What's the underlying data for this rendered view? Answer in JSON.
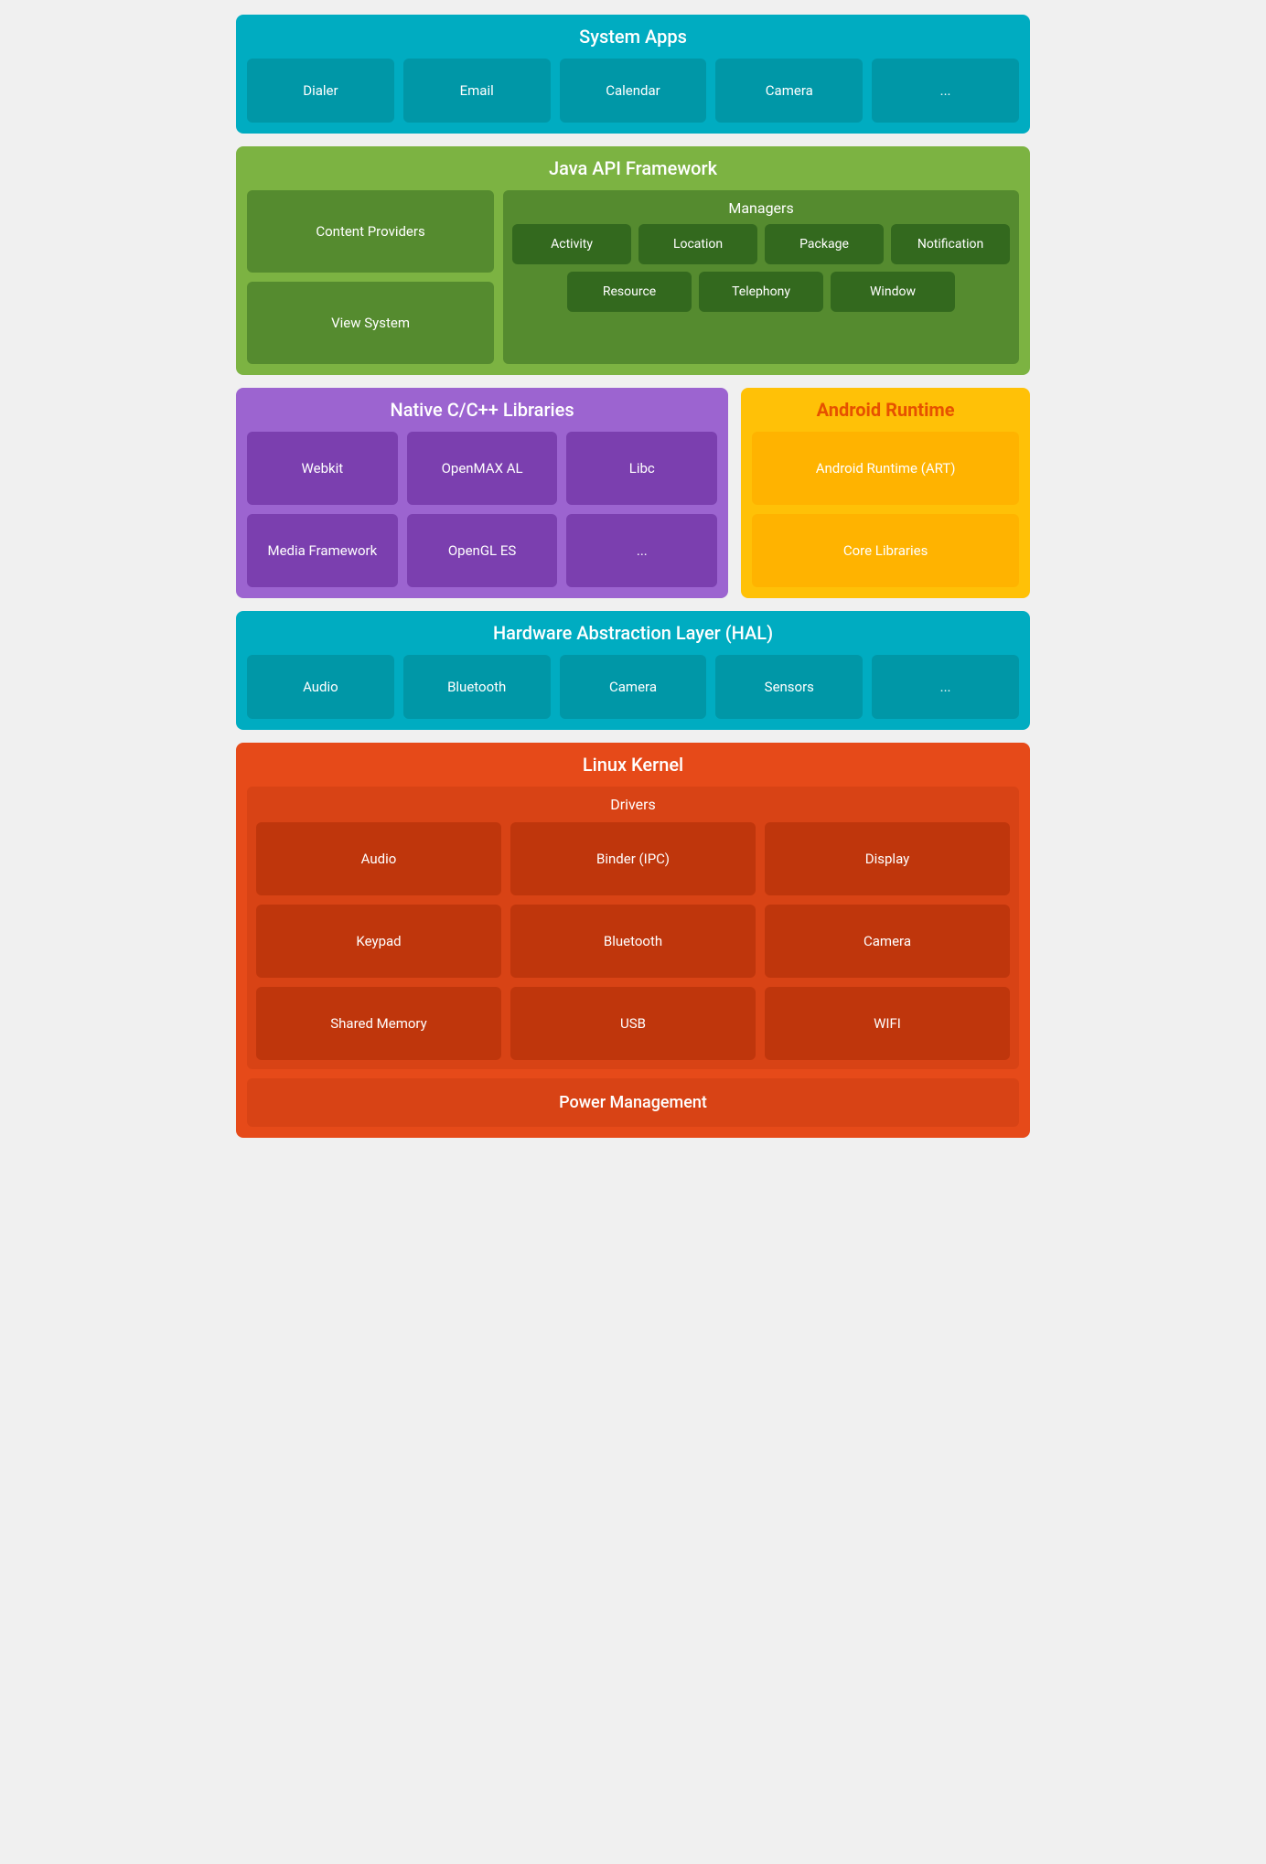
{
  "system_apps": {
    "title": "System Apps",
    "tiles": [
      "Dialer",
      "Email",
      "Calendar",
      "Camera",
      "..."
    ]
  },
  "java_api": {
    "title": "Java API Framework",
    "left": [
      "Content Providers",
      "View System"
    ],
    "managers_title": "Managers",
    "managers_row1": [
      "Activity",
      "Location",
      "Package",
      "Notification"
    ],
    "managers_row2": [
      "Resource",
      "Telephony",
      "Window"
    ]
  },
  "native_cpp": {
    "title": "Native C/C++ Libraries",
    "tiles": [
      "Webkit",
      "OpenMAX AL",
      "Libc",
      "Media Framework",
      "OpenGL ES",
      "..."
    ]
  },
  "android_runtime": {
    "title": "Android Runtime",
    "tiles": [
      "Android Runtime (ART)",
      "Core Libraries"
    ]
  },
  "hal": {
    "title": "Hardware Abstraction Layer (HAL)",
    "tiles": [
      "Audio",
      "Bluetooth",
      "Camera",
      "Sensors",
      "..."
    ]
  },
  "linux_kernel": {
    "title": "Linux Kernel",
    "drivers_title": "Drivers",
    "drivers": [
      "Audio",
      "Binder (IPC)",
      "Display",
      "Keypad",
      "Bluetooth",
      "Camera",
      "Shared Memory",
      "USB",
      "WIFI"
    ],
    "power_management": "Power Management"
  }
}
